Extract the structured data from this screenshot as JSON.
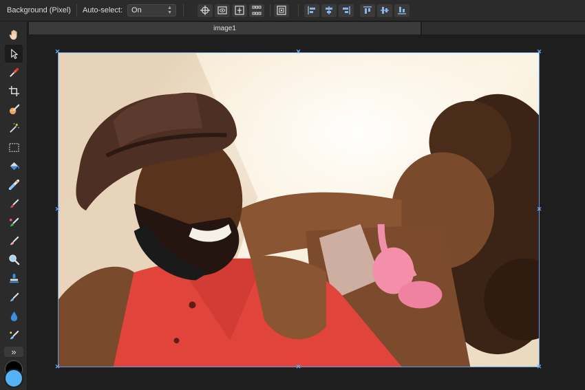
{
  "context_toolbar": {
    "layer_name": "Background (Pixel)",
    "auto_select_label": "Auto-select:",
    "auto_select_value": "On",
    "transform_icons": [
      "move-origin-icon",
      "show-transform-icon",
      "transform-objects-separately-icon",
      "show-alignment-grid-icon",
      "snapping-icon"
    ],
    "align_icons": [
      "align-left-icon",
      "align-center-icon",
      "align-right-icon",
      "align-top-icon",
      "align-middle-icon",
      "align-bottom-icon"
    ]
  },
  "tools": [
    {
      "name": "view-tool",
      "icon": "hand-icon"
    },
    {
      "name": "move-tool",
      "icon": "arrow-pointer-icon",
      "active": true
    },
    {
      "name": "color-picker-tool",
      "icon": "eyedropper-icon"
    },
    {
      "name": "crop-tool",
      "icon": "crop-icon"
    },
    {
      "name": "selection-brush-tool",
      "icon": "selection-brush-icon"
    },
    {
      "name": "flood-select-tool",
      "icon": "magic-wand-icon"
    },
    {
      "name": "marquee-tool",
      "icon": "marquee-icon"
    },
    {
      "name": "flood-fill-tool",
      "icon": "paint-bucket-icon"
    },
    {
      "name": "gradient-tool",
      "icon": "gradient-icon"
    },
    {
      "name": "paint-brush-tool",
      "icon": "paint-brush-icon"
    },
    {
      "name": "color-replacement-tool",
      "icon": "color-replace-brush-icon"
    },
    {
      "name": "erase-brush-tool",
      "icon": "eraser-icon"
    },
    {
      "name": "dodge-tool",
      "icon": "dodge-icon"
    },
    {
      "name": "clone-tool",
      "icon": "stamp-icon"
    },
    {
      "name": "smudge-tool",
      "icon": "smudge-icon"
    },
    {
      "name": "blur-tool",
      "icon": "drop-icon"
    },
    {
      "name": "inpainting-tool",
      "icon": "inpainting-brush-icon"
    }
  ],
  "more_tools_label": "»",
  "colors": {
    "primary": "#55b3f5",
    "secondary": "#000000",
    "accent": "#5f9de8"
  },
  "document": {
    "tab_title": "image1"
  }
}
